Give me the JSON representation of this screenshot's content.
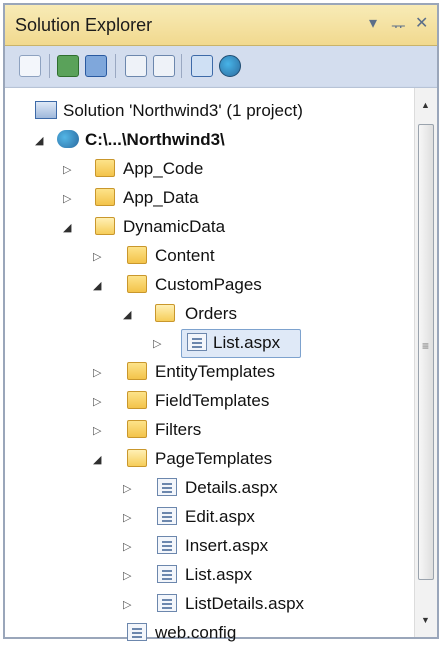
{
  "window": {
    "title": "Solution Explorer",
    "dropdown_glyph": "▾",
    "pin_glyph": "ᅲ",
    "close_glyph": "✕"
  },
  "toolbar": {
    "buttons": [
      {
        "name": "properties-icon"
      },
      {
        "name": "refresh-icon"
      },
      {
        "name": "show-all-files-icon"
      },
      {
        "name": "view-code-icon"
      },
      {
        "name": "view-designer-icon"
      },
      {
        "name": "view-class-diagram-icon"
      },
      {
        "name": "asp-net-configuration-icon"
      }
    ]
  },
  "tree": {
    "solution": "Solution 'Northwind3' (1 project)",
    "project": "C:\\...\\Northwind3\\",
    "app_code": "App_Code",
    "app_data": "App_Data",
    "dynamic_data": "DynamicData",
    "content": "Content",
    "custom_pages": "CustomPages",
    "orders": "Orders",
    "orders_list": "List.aspx",
    "entity_templates": "EntityTemplates",
    "field_templates": "FieldTemplates",
    "filters": "Filters",
    "page_templates": "PageTemplates",
    "details": "Details.aspx",
    "edit": "Edit.aspx",
    "insert": "Insert.aspx",
    "list": "List.aspx",
    "list_details": "ListDetails.aspx",
    "web_config": "web.config"
  },
  "expanders": {
    "open": "◢",
    "closed": "▷"
  },
  "scrollbar": {
    "up": "▲",
    "down": "▼",
    "grip": "≡"
  },
  "colors": {
    "titlebar": "#f3dfa0",
    "toolbar": "#d3ddee",
    "selection": "#dfe9f7",
    "folder": "#f3c34a"
  }
}
